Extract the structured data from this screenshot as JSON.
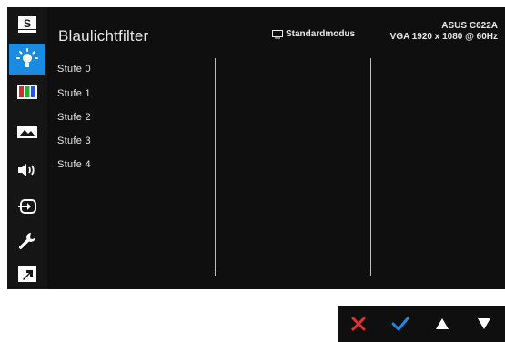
{
  "header": {
    "title": "Blaulichtfilter",
    "mode_label": "Standardmodus",
    "model": "ASUS C622A",
    "resolution": "VGA 1920 x 1080 @ 60Hz"
  },
  "sidebar": {
    "items": [
      {
        "icon": "splendid-icon",
        "active": false
      },
      {
        "icon": "blue-light-icon",
        "active": true
      },
      {
        "icon": "color-bars-icon",
        "active": false
      },
      {
        "icon": "image-icon",
        "active": false
      },
      {
        "icon": "speaker-icon",
        "active": false
      },
      {
        "icon": "input-select-icon",
        "active": false
      },
      {
        "icon": "wrench-icon",
        "active": false
      },
      {
        "icon": "shortcut-icon",
        "active": false
      }
    ]
  },
  "options": [
    "Stufe 0",
    "Stufe 1",
    "Stufe 2",
    "Stufe 3",
    "Stufe 4"
  ],
  "buttons": [
    {
      "icon": "close-icon",
      "color": "#e03030"
    },
    {
      "icon": "check-icon",
      "color": "#1a8be0"
    },
    {
      "icon": "up-arrow-icon",
      "color": "#ffffff"
    },
    {
      "icon": "down-arrow-icon",
      "color": "#ffffff"
    }
  ],
  "colors": {
    "accent": "#1a8be0",
    "background": "#0f0f10"
  }
}
